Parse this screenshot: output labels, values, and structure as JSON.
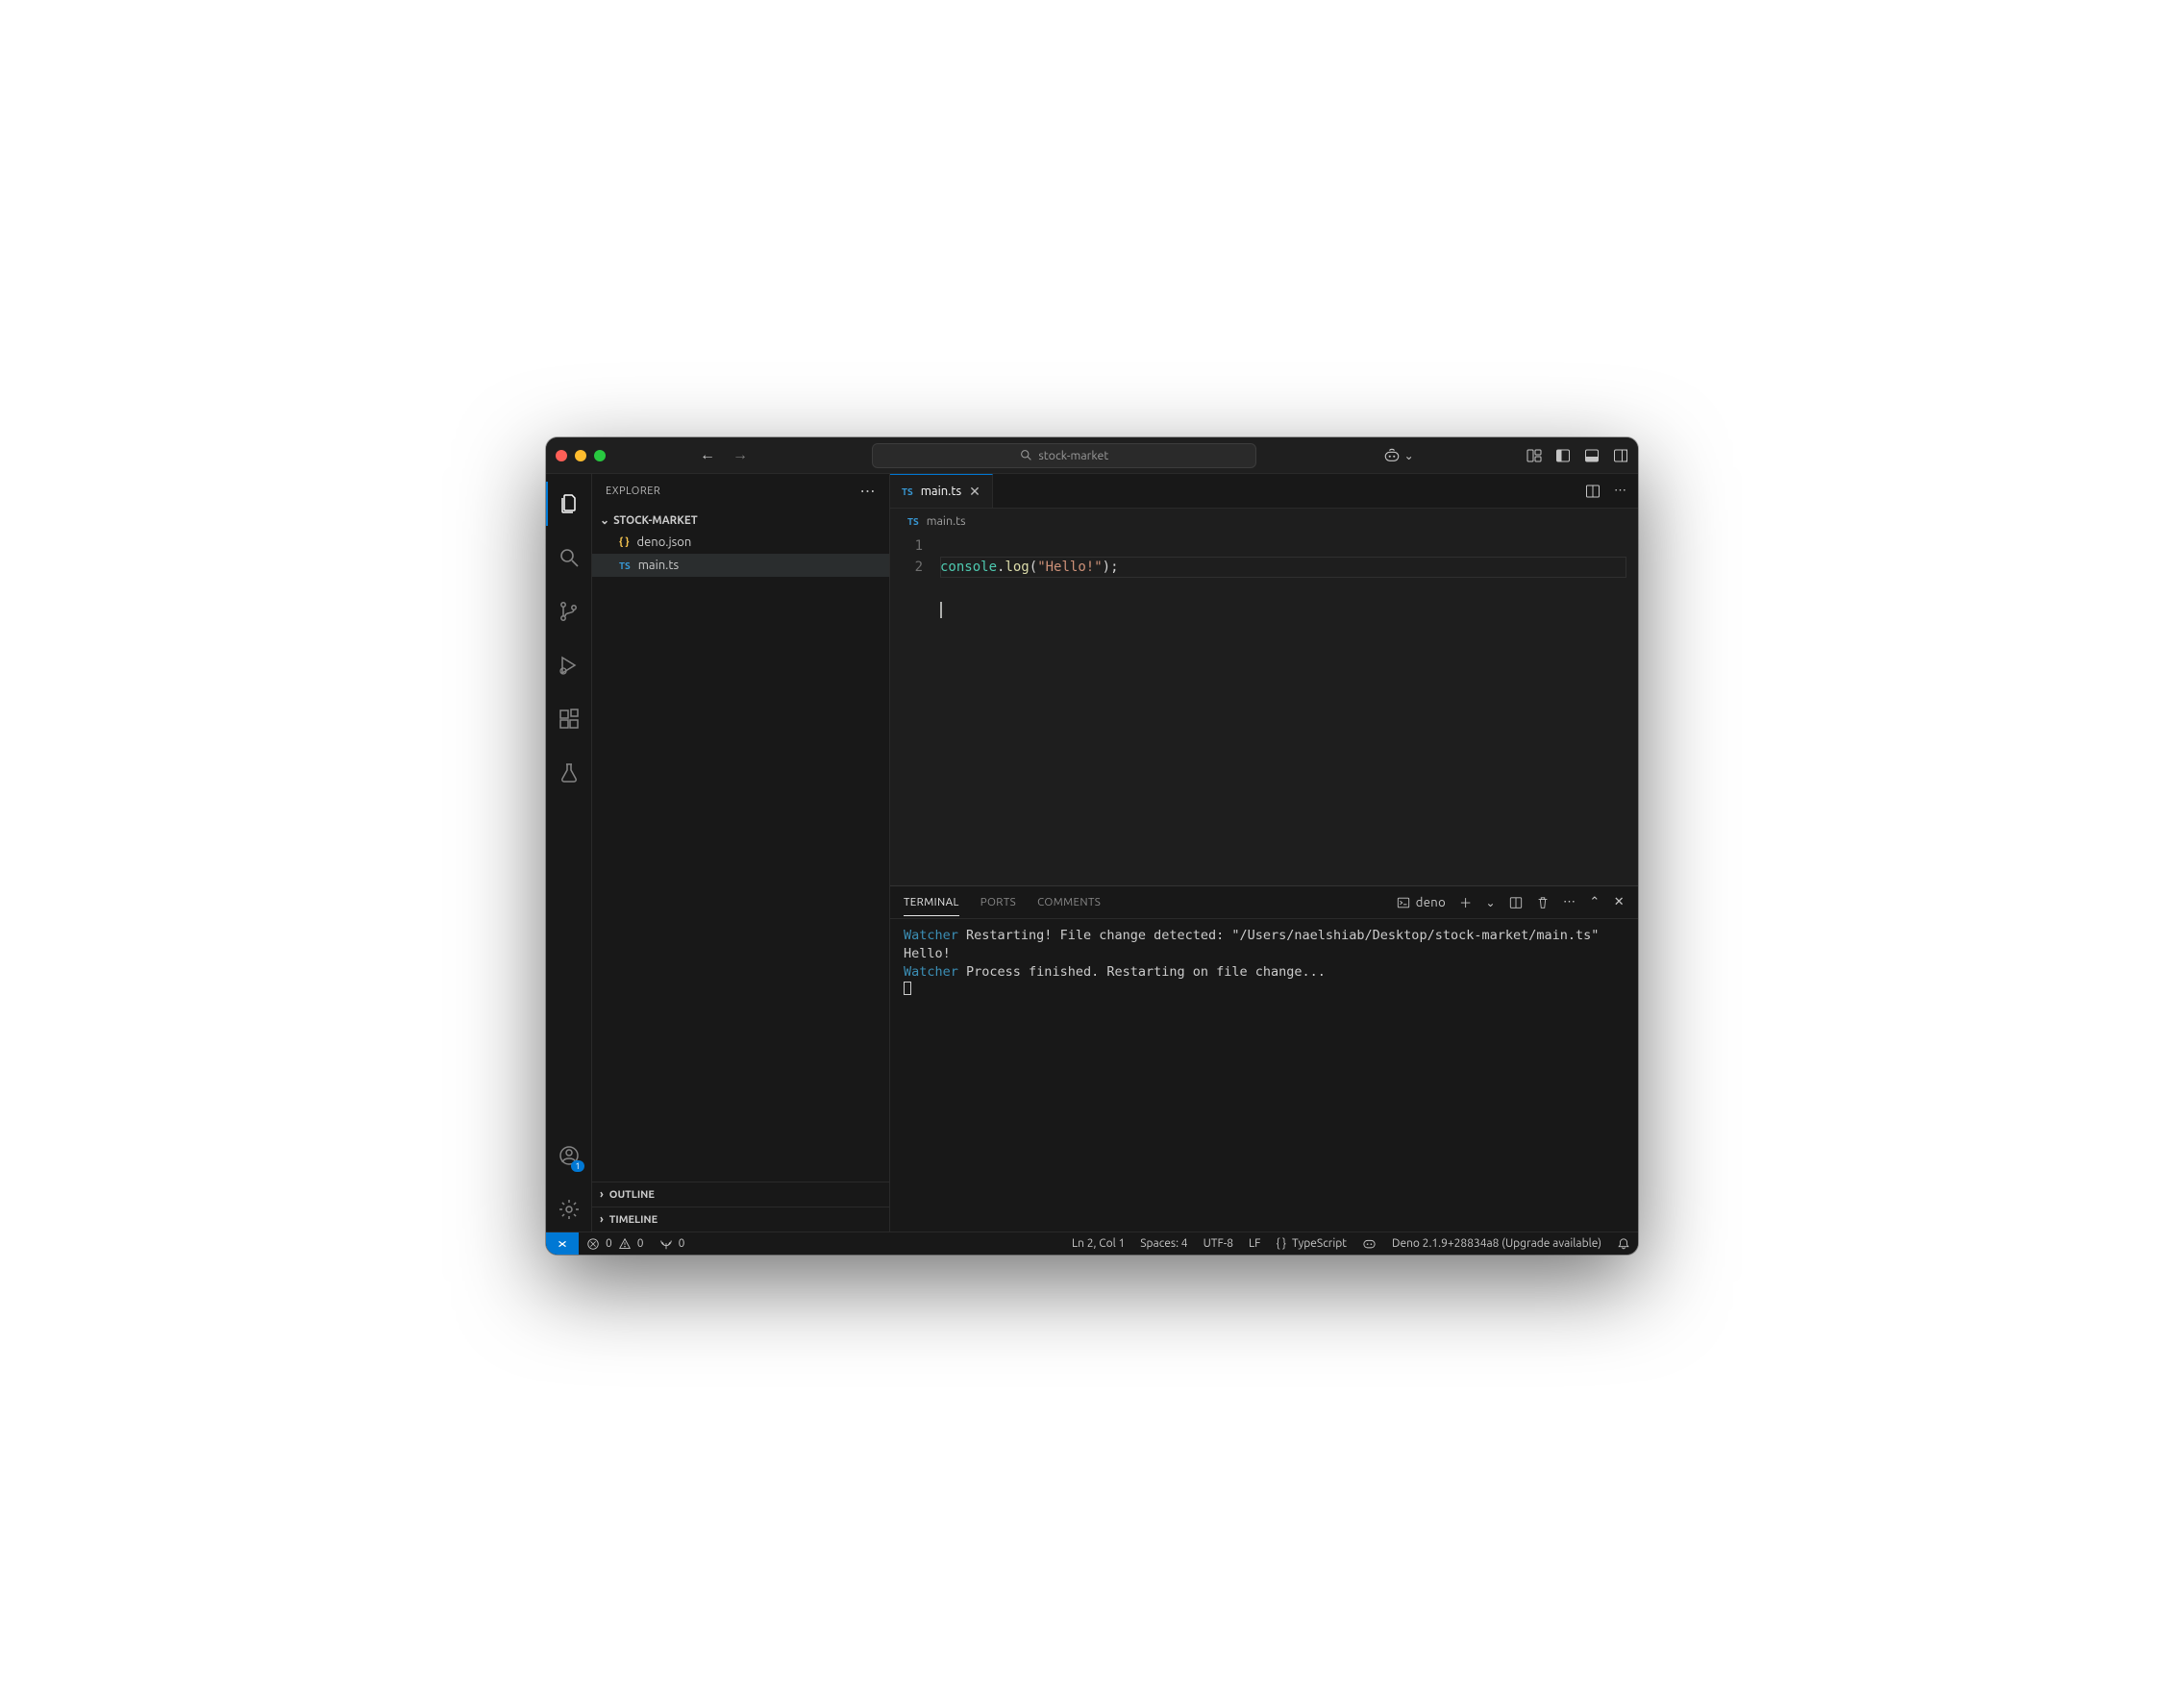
{
  "title": {
    "search_text": "stock-market"
  },
  "sidebar": {
    "title": "EXPLORER",
    "project": "STOCK-MARKET",
    "files": [
      {
        "icon": "json",
        "name": "deno.json"
      },
      {
        "icon": "ts",
        "name": "main.ts"
      }
    ],
    "outline": "OUTLINE",
    "timeline": "TIMELINE"
  },
  "tabs": [
    {
      "icon": "ts",
      "name": "main.ts"
    }
  ],
  "breadcrumb": {
    "icon": "ts",
    "name": "main.ts"
  },
  "editor": {
    "lines": [
      "1",
      "2"
    ],
    "code": {
      "obj": "console",
      "dot": ".",
      "fn": "log",
      "open": "(",
      "str": "\"Hello!\"",
      "close": ")",
      "semi": ";"
    }
  },
  "panel": {
    "tabs": {
      "terminal": "TERMINAL",
      "ports": "PORTS",
      "comments": "COMMENTS"
    },
    "terminal_label": "deno",
    "output": {
      "w1": "Watcher",
      "l1": " Restarting! File change detected: \"/Users/naelshiab/Desktop/stock-market/main.ts\"",
      "l2": "Hello!",
      "w2": "Watcher",
      "l3": " Process finished. Restarting on file change..."
    }
  },
  "status": {
    "errors": "0",
    "warnings": "0",
    "ports": "0",
    "cursor": "Ln 2, Col 1",
    "spaces": "Spaces: 4",
    "encoding": "UTF-8",
    "eol": "LF",
    "lang": "TypeScript",
    "deno": "Deno 2.1.9+28834a8 (Upgrade available)"
  },
  "account_badge": "1"
}
